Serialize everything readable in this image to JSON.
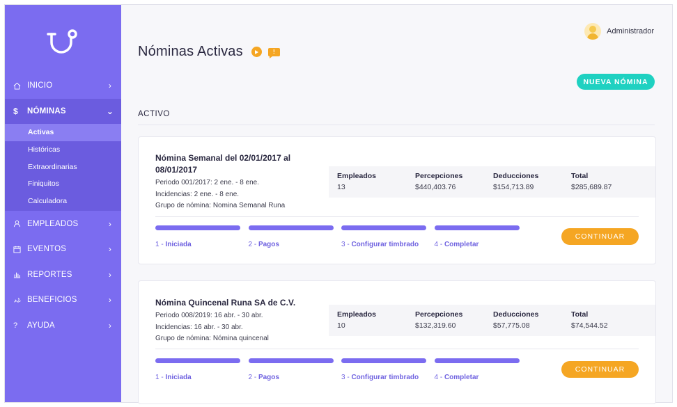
{
  "sidebar": {
    "items": [
      {
        "label": "INICIO",
        "icon": "home-icon"
      },
      {
        "label": "NÓMINAS",
        "icon": "dollar-icon",
        "open": true
      },
      {
        "label": "EMPLEADOS",
        "icon": "user-icon"
      },
      {
        "label": "EVENTOS",
        "icon": "calendar-icon"
      },
      {
        "label": "REPORTES",
        "icon": "bar-chart-icon"
      },
      {
        "label": "BENEFICIOS",
        "icon": "benefits-icon"
      },
      {
        "label": "AYUDA",
        "icon": "help-icon"
      }
    ],
    "subitems": [
      "Activas",
      "Históricas",
      "Extraordinarias",
      "Finiquitos",
      "Calculadora"
    ],
    "accent": "#7b6cf0"
  },
  "header": {
    "user_name": "Administrador",
    "title": "Nóminas Activas",
    "chat_badge": "!",
    "new_button": "NUEVA NÓMINA"
  },
  "section": {
    "label": "ACTIVO"
  },
  "stat_headers": [
    "Empleados",
    "Percepciones",
    "Deducciones",
    "Total"
  ],
  "steps": [
    {
      "num": "1 - ",
      "label": "Iniciada"
    },
    {
      "num": "2 - ",
      "label": "Pagos"
    },
    {
      "num": "3 - ",
      "label": "Configurar timbrado"
    },
    {
      "num": "4 - ",
      "label": "Completar"
    }
  ],
  "cards": [
    {
      "title": "Nómina Semanal del 02/01/2017 al 08/01/2017",
      "periodo": "Periodo 001/2017: 2 ene. - 8 ene.",
      "incidencias": "Incidencias: 2 ene. - 8 ene.",
      "grupo": "Grupo de nómina: Nomina Semanal Runa",
      "stats": [
        "13",
        "$440,403.76",
        "$154,713.89",
        "$285,689.87"
      ],
      "button": "CONTINUAR"
    },
    {
      "title": "Nómina Quincenal Runa SA de C.V.",
      "periodo": "Periodo 008/2019: 16 abr. - 30 abr.",
      "incidencias": "Incidencias: 16 abr. - 30 abr.",
      "grupo": "Grupo de nómina: Nómina quincenal",
      "stats": [
        "10",
        "$132,319.60",
        "$57,775.08",
        "$74,544.52"
      ],
      "button": "CONTINUAR"
    }
  ]
}
